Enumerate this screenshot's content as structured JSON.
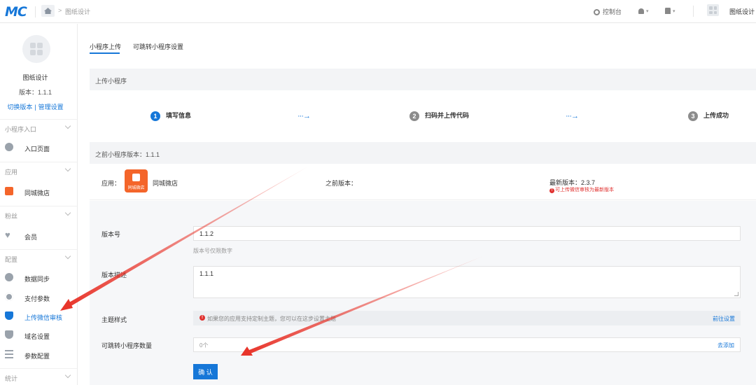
{
  "header": {
    "logo_text": "MC",
    "breadcrumb_arrow": ">",
    "breadcrumb_page": "图纸设计",
    "console_label": "控制台",
    "caret": "▾",
    "user_name": "图纸设计",
    "brand_color": "#1677d8"
  },
  "sidebar": {
    "app_name": "图纸设计",
    "app_version": "版本：1.1.1",
    "switch_version": "切换版本",
    "divider": "|",
    "manage_settings": "管理设置",
    "groups": {
      "entry": "小程序入口",
      "apps": "应用",
      "fans": "粉丝",
      "config": "配置",
      "stats": "统计"
    },
    "items": {
      "entry_page": "入口页面",
      "shop": "同城微店",
      "member": "会员",
      "data_sync": "数据同步",
      "payment": "支付参数",
      "upload_review": "上传微信审核",
      "domain": "域名设置",
      "param_config": "参数配置"
    }
  },
  "tabs": {
    "upload": "小程序上传",
    "jump_settings": "可跳转小程序设置"
  },
  "upload_panel": {
    "title": "上传小程序",
    "steps": [
      {
        "num": "1",
        "label": "填写信息",
        "state": "active"
      },
      {
        "num": "2",
        "label": "扫码并上传代码",
        "state": "pending"
      },
      {
        "num": "3",
        "label": "上传成功",
        "state": "pending"
      }
    ],
    "step_arrow": "···→"
  },
  "previous": {
    "title": "之前小程序版本：1.1.1",
    "app_label": "应用：",
    "app_name": "同城微店",
    "app_thumb_text": "同城微店",
    "previous_version_label": "之前版本：",
    "latest_version": "最新版本：2.3.7",
    "latest_tip_icon": "!",
    "latest_tip": "可上传微信审核为最新版本"
  },
  "form": {
    "version_label": "版本号",
    "version_value": "1.1.2",
    "version_help": "版本号仅限数字",
    "desc_label": "版本描述",
    "desc_value": "1.1.1",
    "theme_label": "主题样式",
    "theme_notice_icon": "!",
    "theme_notice": "如果您的应用支持定制主题，您可以在这步设置主题",
    "theme_link": "前往设置",
    "jump_count_label": "可跳转小程序数量",
    "jump_count_value": "0个",
    "jump_add_link": "去添加",
    "confirm_label": "确 认"
  }
}
